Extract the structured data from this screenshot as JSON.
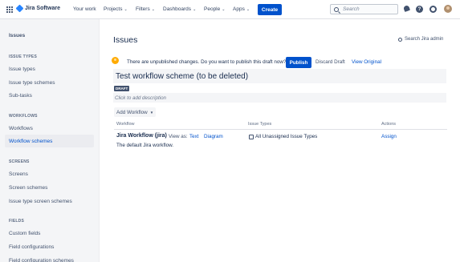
{
  "topbar": {
    "product": "Jira Software",
    "nav": [
      {
        "label": "Your work",
        "dropdown": false
      },
      {
        "label": "Projects",
        "dropdown": true
      },
      {
        "label": "Filters",
        "dropdown": true
      },
      {
        "label": "Dashboards",
        "dropdown": true
      },
      {
        "label": "People",
        "dropdown": true
      },
      {
        "label": "Apps",
        "dropdown": true
      }
    ],
    "create_label": "Create",
    "search_placeholder": "Search",
    "help_glyph": "?",
    "icons": [
      "app-switcher-icon",
      "jira-logo-icon",
      "search-icon",
      "notifications-icon",
      "help-icon",
      "settings-icon",
      "avatar"
    ],
    "colors": {
      "brand": "#0052cc",
      "logo": "#2684ff"
    }
  },
  "sidebar": {
    "title": "Issues",
    "sections": [
      {
        "label": "ISSUE TYPES",
        "items": [
          "Issue types",
          "Issue type schemes",
          "Sub-tasks"
        ]
      },
      {
        "label": "WORKFLOWS",
        "items": [
          "Workflows",
          "Workflow schemes"
        ]
      },
      {
        "label": "SCREENS",
        "items": [
          "Screens",
          "Screen schemes",
          "Issue type screen schemes"
        ]
      },
      {
        "label": "FIELDS",
        "items": [
          "Custom fields",
          "Field configurations",
          "Field configuration schemes"
        ]
      }
    ],
    "selected_item": "Workflow schemes"
  },
  "main": {
    "title": "Issues",
    "search_admin": "Search Jira admin",
    "notice": "There are unpublished changes. Do you want to publish this draft now?",
    "publish_label": "Publish",
    "discard_label": "Discard Draft",
    "view_original_label": "View Original",
    "scheme_name": "Test workflow scheme (to be deleted)",
    "draft_lozenge": "DRAFT",
    "description_placeholder": "Click to add description",
    "add_workflow_label": "Add Workflow",
    "table": {
      "headers": {
        "workflow": "Workflow",
        "issue_types": "Issue Types",
        "actions": "Actions"
      },
      "rows": [
        {
          "workflow": "Jira Workflow (jira)",
          "view_as": "View as:",
          "text_link": "Text",
          "diagram_link": "Diagram",
          "description": "The default Jira workflow.",
          "issue_types": "All Unassigned Issue Types",
          "action": "Assign"
        }
      ]
    }
  }
}
